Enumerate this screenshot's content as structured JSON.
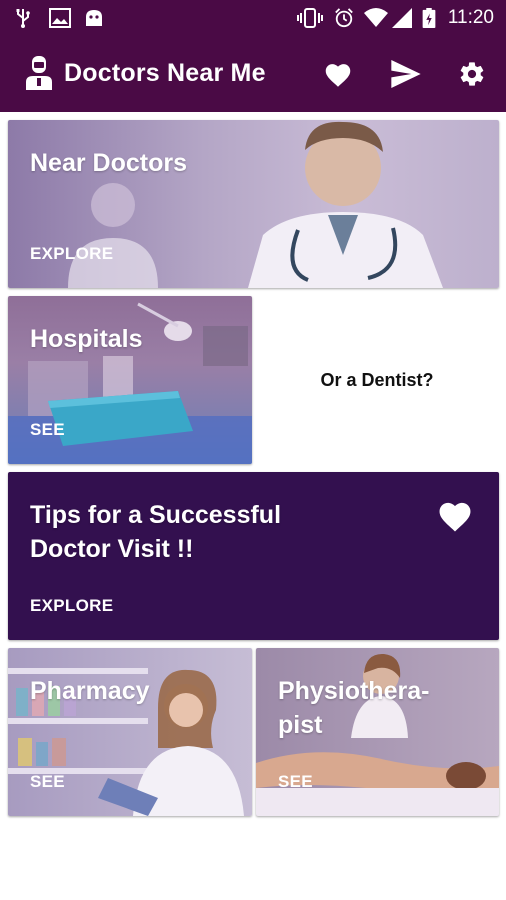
{
  "status": {
    "time": "11:20"
  },
  "app": {
    "title": "Doctors Near Me"
  },
  "cards": {
    "near_doctors": {
      "title": "Near Doctors",
      "action": "EXPLORE"
    },
    "hospitals": {
      "title": "Hospitals",
      "action": "SEE"
    },
    "dentist": {
      "label": "Or a Dentist?"
    },
    "tips": {
      "title_line1": "Tips for a Successful",
      "title_line2": "Doctor Visit !!",
      "action": "EXPLORE"
    },
    "pharmacy": {
      "title": "Pharmacy",
      "action": "SEE"
    },
    "physio": {
      "title_line1": "Physiothera-",
      "title_line2": "pist",
      "action": "SEE"
    }
  },
  "colors": {
    "brand": "#4a0a45",
    "tips_card": "#33104f",
    "photo_overlay": "#6a3a7a"
  },
  "icons": [
    "usb-icon",
    "image-icon",
    "android-icon",
    "vibrate-icon",
    "alarm-icon",
    "wifi-icon",
    "signal-icon",
    "battery-icon",
    "doctor-icon",
    "heart-icon",
    "send-icon",
    "settings-icon"
  ]
}
